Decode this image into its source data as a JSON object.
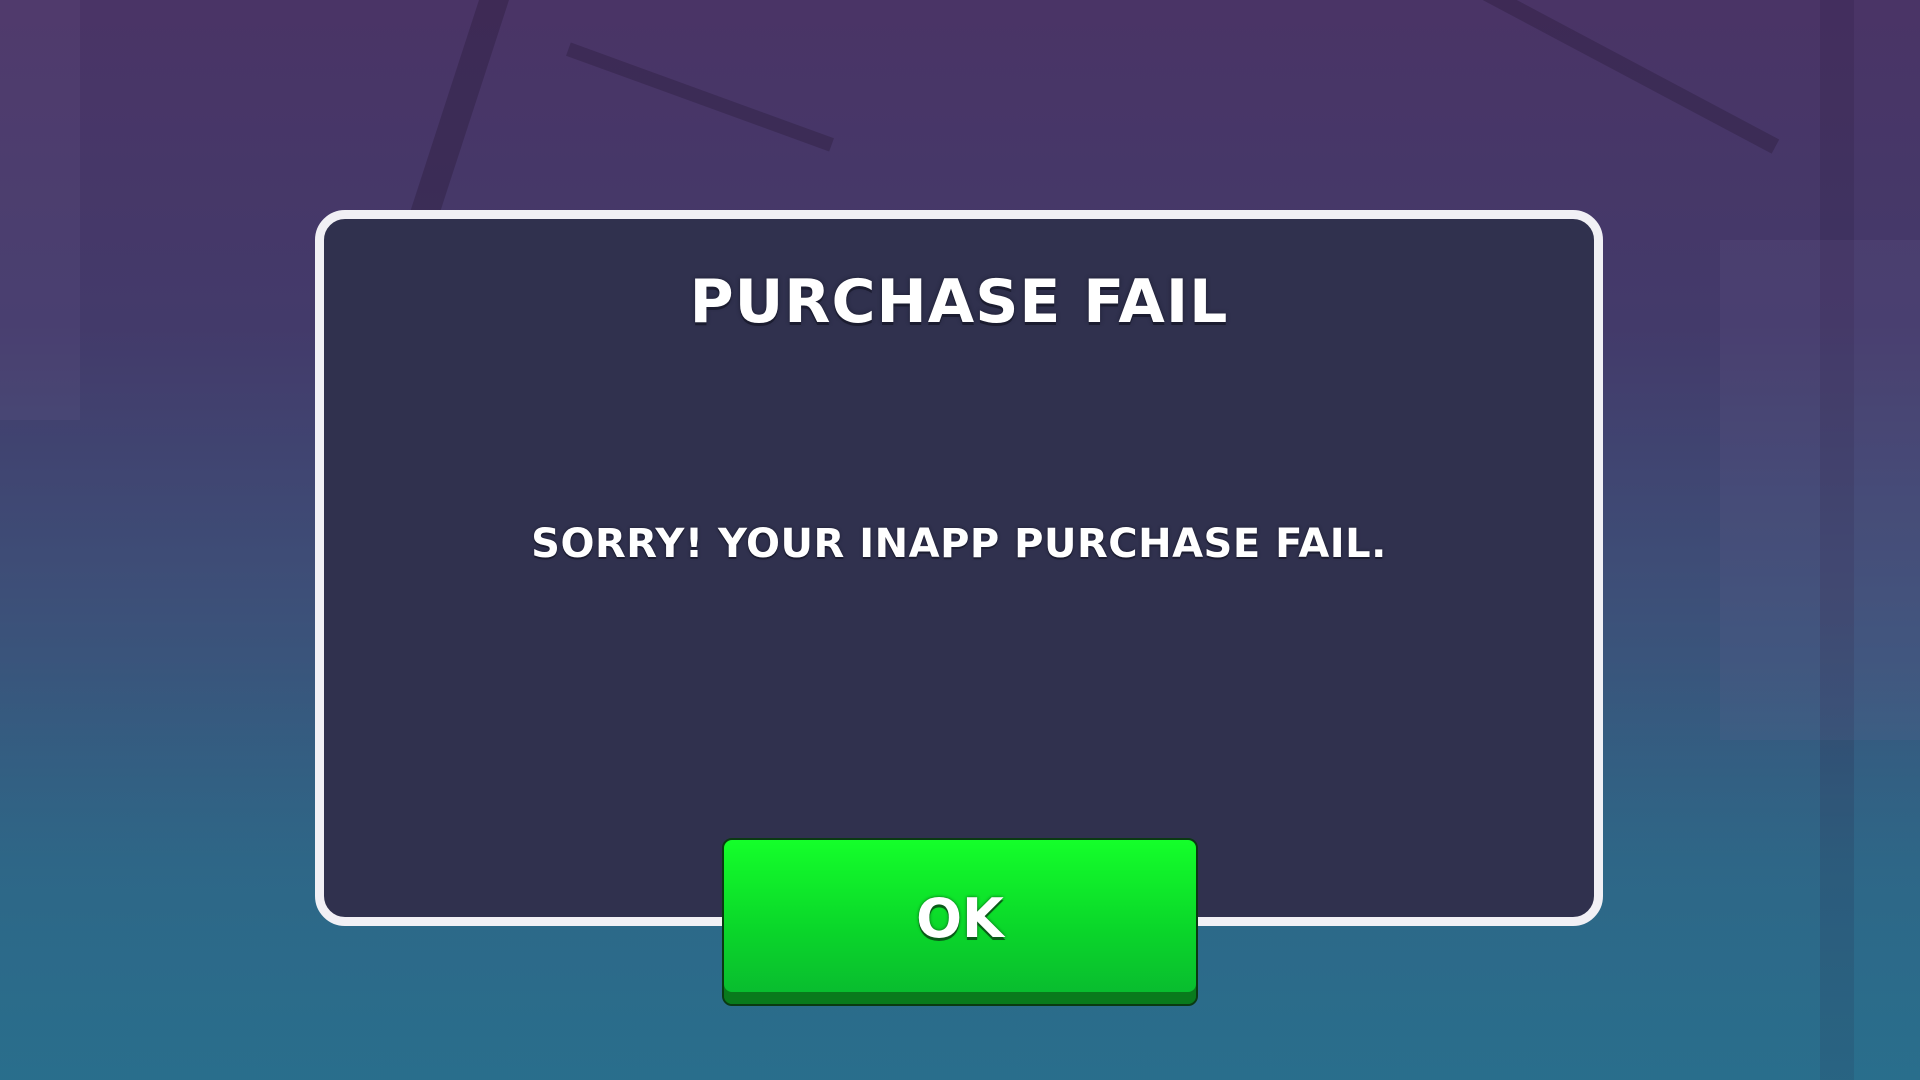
{
  "dialog": {
    "title": "PURCHASE FAIL",
    "message": "SORRY! YOUR INAPP PURCHASE FAIL."
  },
  "buttons": {
    "ok_label": "OK"
  },
  "colors": {
    "dialog_background": "#30314e",
    "dialog_border": "#f1f0f5",
    "ok_button": "#0ad62a"
  }
}
